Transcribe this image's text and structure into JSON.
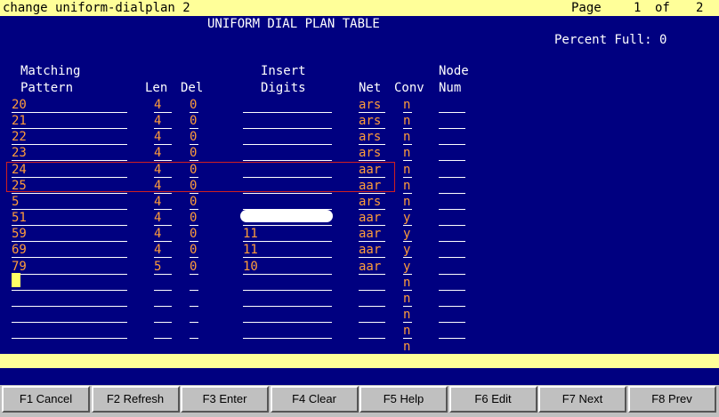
{
  "header": {
    "command": "change uniform-dialplan 2",
    "page_label": "Page",
    "page_current": "1",
    "page_of": "of",
    "page_total": "2"
  },
  "title": "UNIFORM DIAL PLAN TABLE",
  "percent_full": "Percent Full: 0",
  "columns": {
    "matching_line1": "Matching",
    "matching_line2": "Pattern",
    "len": "Len",
    "del": "Del",
    "insert_line1": "Insert",
    "insert_line2": "Digits",
    "net": "Net",
    "conv": "Conv",
    "node_line1": "Node",
    "node_line2": "Num"
  },
  "rows": [
    {
      "pattern": "20",
      "len": "4",
      "del": "0",
      "insert": "",
      "net": "ars",
      "conv": "n",
      "node": ""
    },
    {
      "pattern": "21",
      "len": "4",
      "del": "0",
      "insert": "",
      "net": "ars",
      "conv": "n",
      "node": ""
    },
    {
      "pattern": "22",
      "len": "4",
      "del": "0",
      "insert": "",
      "net": "ars",
      "conv": "n",
      "node": ""
    },
    {
      "pattern": "23",
      "len": "4",
      "del": "0",
      "insert": "",
      "net": "ars",
      "conv": "n",
      "node": ""
    },
    {
      "pattern": "24",
      "len": "4",
      "del": "0",
      "insert": "",
      "net": "aar",
      "conv": "n",
      "node": ""
    },
    {
      "pattern": "25",
      "len": "4",
      "del": "0",
      "insert": "",
      "net": "aar",
      "conv": "n",
      "node": ""
    },
    {
      "pattern": "5",
      "len": "4",
      "del": "0",
      "insert": "",
      "net": "ars",
      "conv": "n",
      "node": ""
    },
    {
      "pattern": "51",
      "len": "4",
      "del": "0",
      "insert": "",
      "net": "aar",
      "conv": "y",
      "node": ""
    },
    {
      "pattern": "59",
      "len": "4",
      "del": "0",
      "insert": "11",
      "net": "aar",
      "conv": "y",
      "node": ""
    },
    {
      "pattern": "69",
      "len": "4",
      "del": "0",
      "insert": "11",
      "net": "aar",
      "conv": "y",
      "node": ""
    },
    {
      "pattern": "79",
      "len": "5",
      "del": "0",
      "insert": "10",
      "net": "aar",
      "conv": "y",
      "node": ""
    },
    {
      "pattern": "",
      "len": "",
      "del": "",
      "insert": "",
      "net": "",
      "conv": "n",
      "node": ""
    },
    {
      "pattern": "",
      "len": "",
      "del": "",
      "insert": "",
      "net": "",
      "conv": "n",
      "node": ""
    },
    {
      "pattern": "",
      "len": "",
      "del": "",
      "insert": "",
      "net": "",
      "conv": "n",
      "node": ""
    },
    {
      "pattern": "",
      "len": "",
      "del": "",
      "insert": "",
      "net": "",
      "conv": "n",
      "node": ""
    },
    {
      "pattern": "",
      "len": "",
      "del": "",
      "insert": "",
      "net": "",
      "conv": "n",
      "node": ""
    }
  ],
  "fkeys": [
    "F1 Cancel",
    "F2 Refresh",
    "F3 Enter",
    "F4 Clear",
    "F5 Help",
    "F6 Edit",
    "F7 Next",
    "F8 Prev"
  ],
  "colors": {
    "background": "#000080",
    "field_text": "#ff9d3b",
    "label_text": "#ffffff",
    "bars": "#ffff99",
    "highlight_box": "#d02020"
  }
}
